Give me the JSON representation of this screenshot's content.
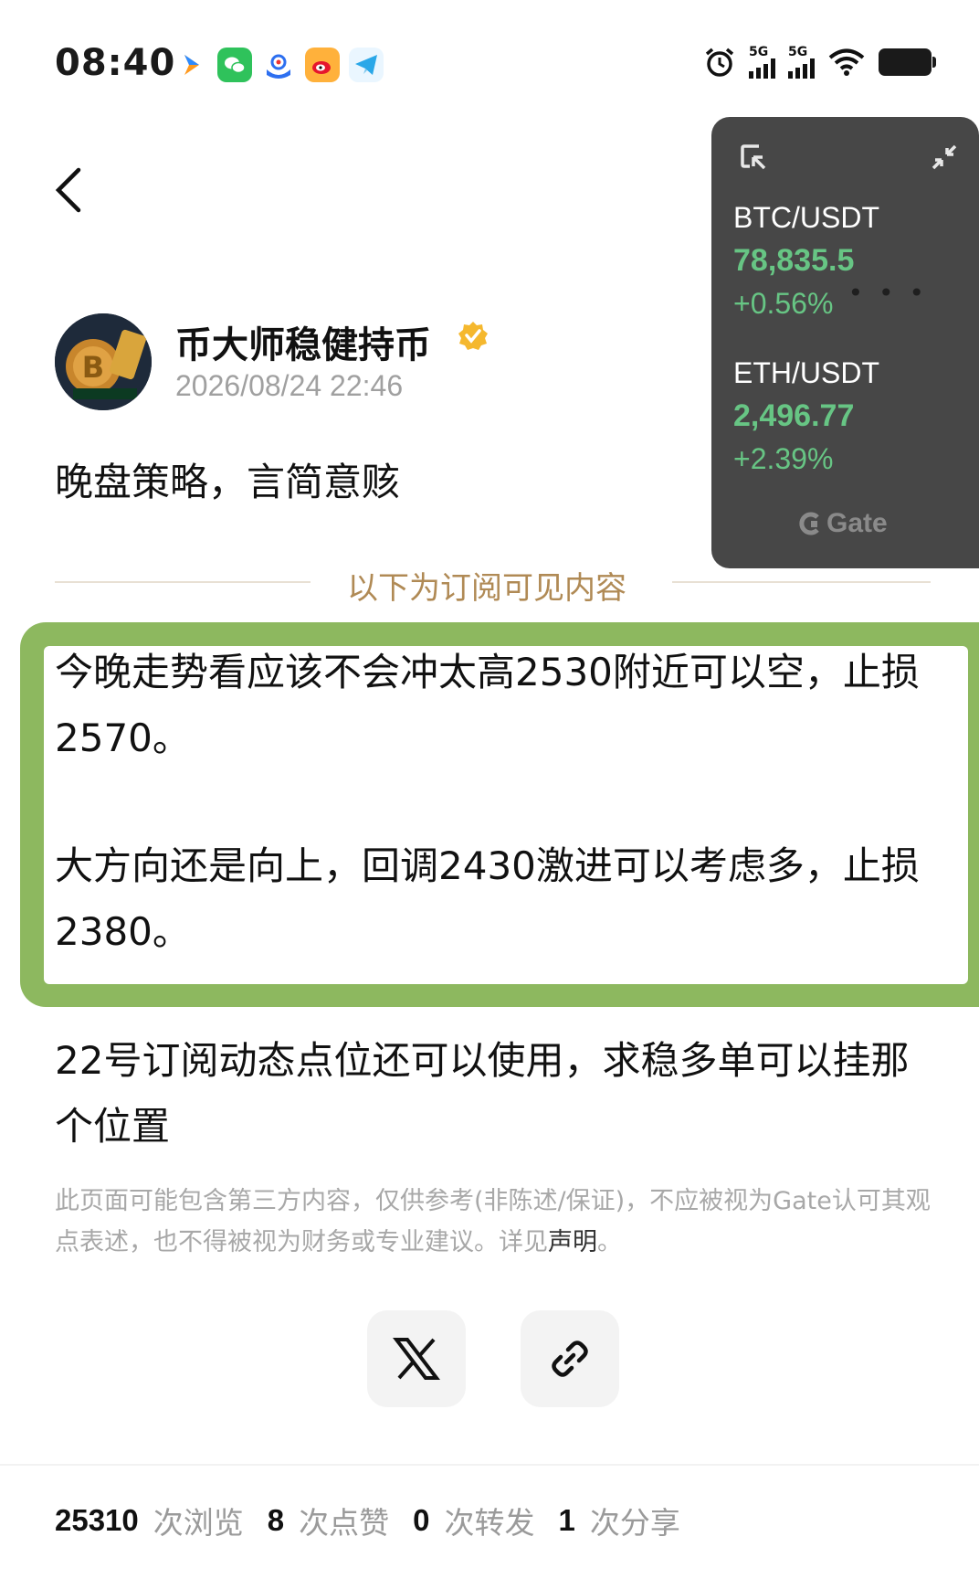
{
  "status_bar": {
    "time": "08:40",
    "network_1": "5G",
    "network_2": "5G",
    "app_icons": [
      "arrow-app-icon",
      "wechat-icon",
      "browser-app-icon",
      "weibo-icon",
      "telegram-icon"
    ]
  },
  "widget": {
    "pairs": [
      {
        "pair": "BTC/USDT",
        "price": "78,835.5",
        "change": "+0.56%"
      },
      {
        "pair": "ETH/USDT",
        "price": "2,496.77",
        "change": "+2.39%"
      }
    ],
    "brand": "Gate",
    "up_color": "#67c584"
  },
  "author": {
    "name": "币大师稳健持币",
    "time": "2026/08/24 22:46"
  },
  "post": {
    "title": "晚盘策略，言简意赅",
    "divider": "以下为订阅可见内容",
    "highlight_para1": "今晚走势看应该不会冲太高2530附近可以空，止损2570。",
    "highlight_para2": "大方向还是向上，回调2430激进可以考虑多，止损2380。",
    "para3": "22号订阅动态点位还可以使用，求稳多单可以挂那个位置",
    "disclaimer": "此页面可能包含第三方内容，仅供参考(非陈述/保证)，不应被视为Gate认可其观点表述，也不得被视为财务或专业建议。详见",
    "disclaimer_link": "声明",
    "disclaimer_end": "。",
    "highlight_color": "#8db85f"
  },
  "stats": {
    "views": "25310",
    "views_label": "次浏览",
    "likes": "8",
    "likes_label": "次点赞",
    "reposts": "0",
    "reposts_label": "次转发",
    "shares": "1",
    "shares_label": "次分享"
  }
}
